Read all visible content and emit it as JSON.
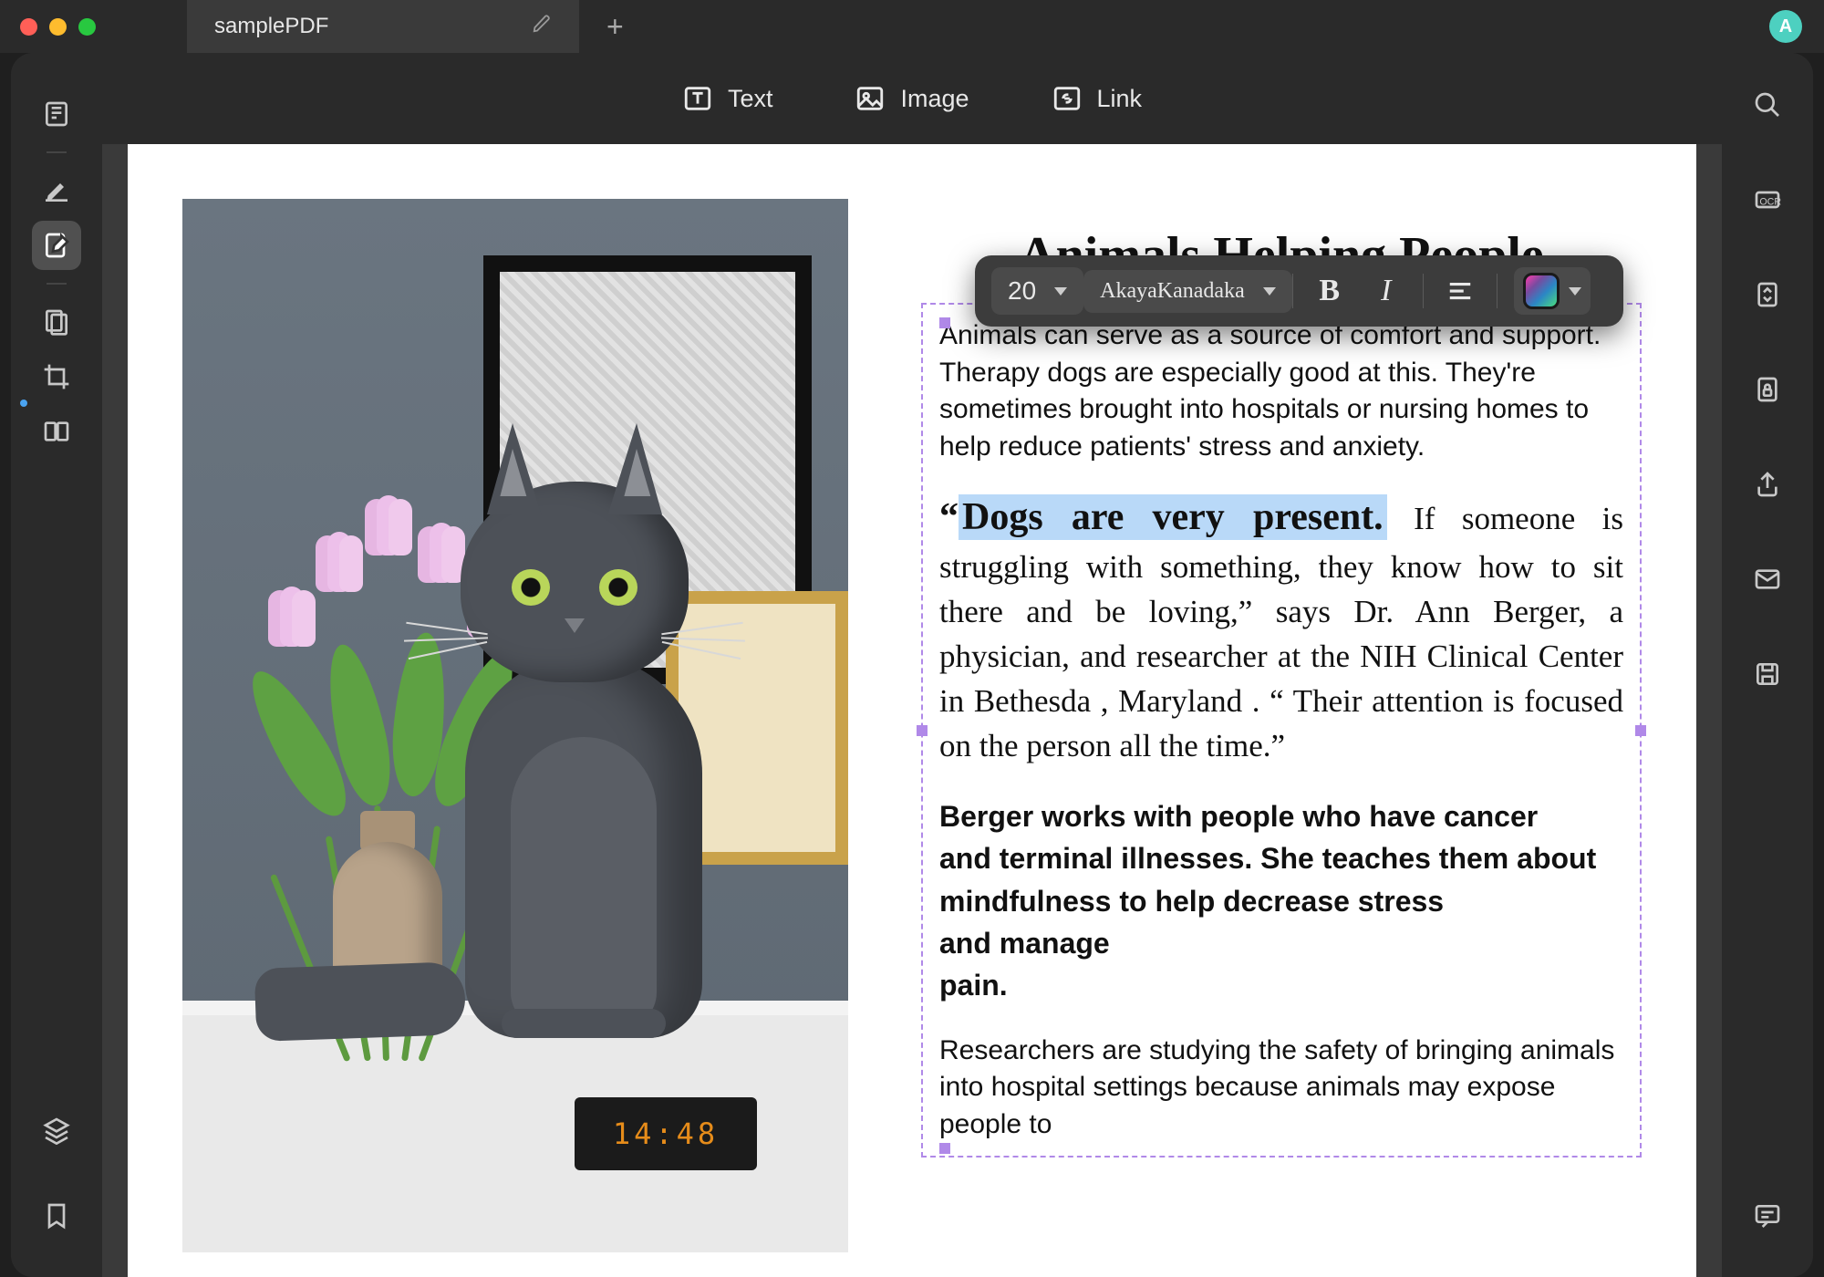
{
  "window": {
    "tab_title": "samplePDF",
    "avatar_initial": "A"
  },
  "top_tools": {
    "text": "Text",
    "image": "Image",
    "link": "Link"
  },
  "font_toolbar": {
    "size": "20",
    "font_name": "AkayaKanadaka"
  },
  "left_sidebar": {
    "items": [
      "thumbnails",
      "annotate",
      "edit",
      "organize",
      "crop",
      "compare"
    ]
  },
  "right_sidebar": {
    "items": [
      "search",
      "ocr",
      "convert",
      "protect",
      "share",
      "email",
      "save"
    ]
  },
  "document": {
    "clock_time": "14:48",
    "title_partial": "Animals Helping People",
    "para1": "Animals can serve as a source of comfort and support. Therapy dogs are especially good at this. They're sometimes brought into hospitals or nursing homes to help reduce patients' stress and anxiety.",
    "quote_open": "“",
    "quote_highlight": "Dogs are very present.",
    "quote_rest": " If someone is struggling with something, they know how to sit there and be loving,”  says Dr.  Ann  Berger,  a  physician,  and researcher at the NIH Clinical Center in  Bethesda ,  Maryland .    “ Their attention  is  focused  on  the person all the time.”",
    "para2": "Berger works with people who have cancer\nand terminal illnesses.  She  teaches them  about mindfulness to help decrease stress\nand manage\npain.",
    "para3": "Researchers are studying the safety of bringing animals into hospital settings because animals may expose people to"
  }
}
